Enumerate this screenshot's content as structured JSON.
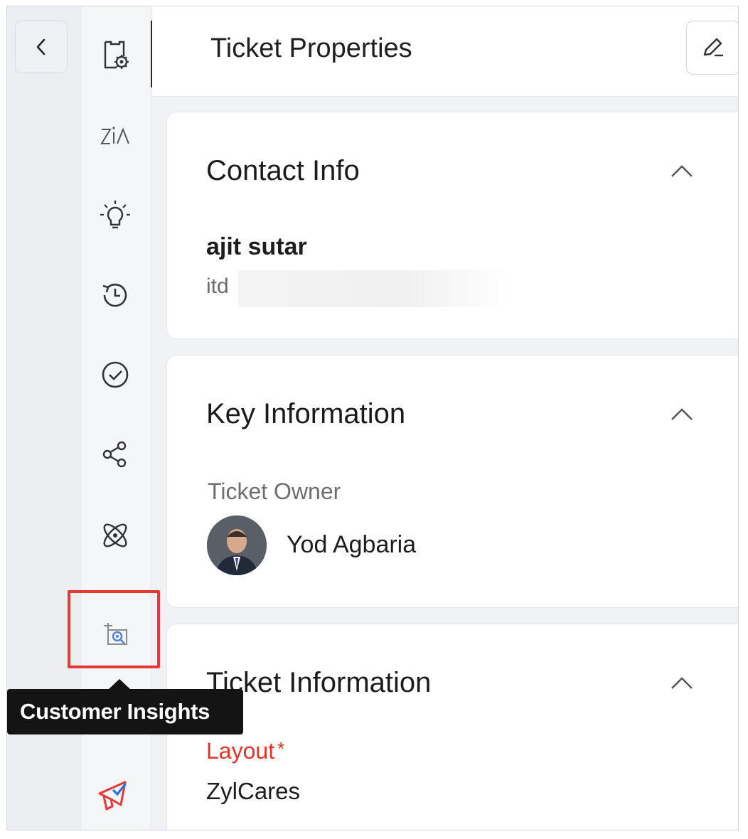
{
  "header": {
    "title": "Ticket Properties"
  },
  "contact_info": {
    "title": "Contact Info",
    "name": "ajit sutar",
    "email_partial": "itd"
  },
  "key_information": {
    "title": "Key Information",
    "ticket_owner_label": "Ticket Owner",
    "ticket_owner_name": "Yod Agbaria"
  },
  "ticket_information": {
    "title": "Ticket Information",
    "layout_label": "Layout",
    "layout_required_mark": "*",
    "layout_value": "ZylCares"
  },
  "tooltip": {
    "text": "Customer Insights"
  },
  "sidebar_icons": [
    "ticket-settings-icon",
    "zia-icon",
    "idea-bulb-icon",
    "history-icon",
    "approval-check-icon",
    "share-icon",
    "atom-icon",
    "customer-insights-icon",
    "list-icon",
    "campaign-megaphone-icon"
  ],
  "colors": {
    "required": "#e0352b",
    "highlight": "#e53935",
    "tooltip_bg": "#141414"
  }
}
